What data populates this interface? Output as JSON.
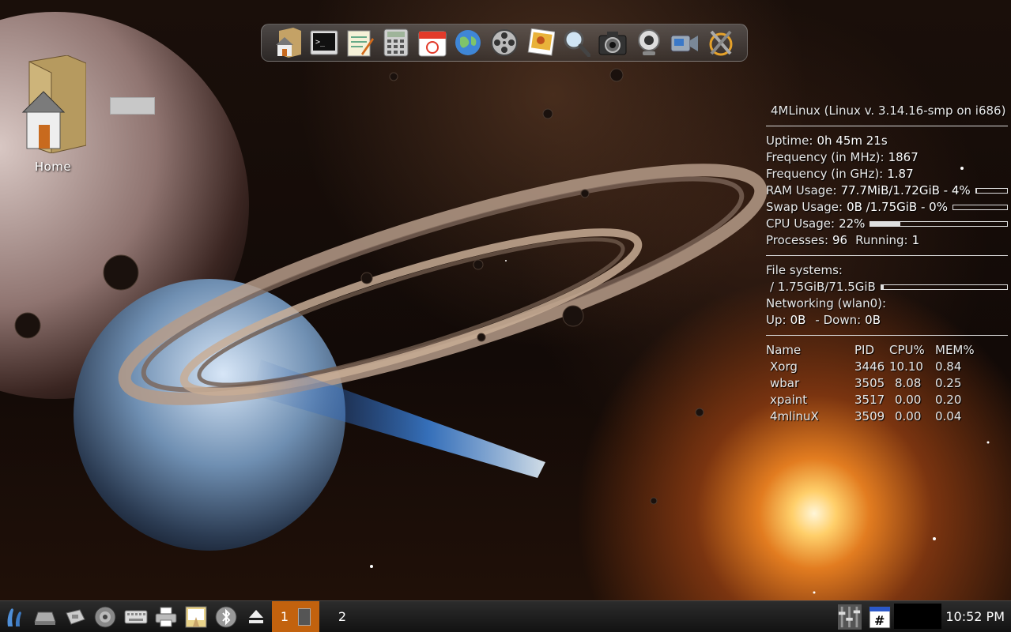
{
  "desktop": {
    "icons": [
      {
        "label": "Home",
        "icon": "home-folder-icon"
      }
    ]
  },
  "dock": {
    "items": [
      {
        "name": "home-folder-icon"
      },
      {
        "name": "terminal-icon"
      },
      {
        "name": "text-editor-icon"
      },
      {
        "name": "calculator-icon"
      },
      {
        "name": "calendar-icon"
      },
      {
        "name": "web-browser-icon"
      },
      {
        "name": "media-player-icon"
      },
      {
        "name": "image-viewer-icon"
      },
      {
        "name": "magnifier-icon"
      },
      {
        "name": "camera-icon"
      },
      {
        "name": "webcam-icon"
      },
      {
        "name": "video-camera-icon"
      },
      {
        "name": "settings-tools-icon"
      }
    ]
  },
  "conky": {
    "title": "4MLinux (Linux v. 3.14.16-smp on i686)",
    "uptime_label": "Uptime:",
    "uptime": "0h 45m 21s",
    "freq_mhz_label": "Frequency (in MHz):",
    "freq_mhz": "1867",
    "freq_ghz_label": "Frequency (in GHz):",
    "freq_ghz": "1.87",
    "ram_label": "RAM Usage:",
    "ram": "77.7MiB/1.72GiB - 4%",
    "ram_pct": 4,
    "swap_label": "Swap Usage:",
    "swap": "0B  /1.75GiB - 0%",
    "swap_pct": 0,
    "cpu_label": "CPU Usage:",
    "cpu": "22%",
    "cpu_pct": 22,
    "processes_label": "Processes:",
    "processes": "96",
    "running_label": "Running:",
    "running": "1",
    "fs_label": "File systems:",
    "fs_root": "/ 1.75GiB/71.5GiB",
    "fs_pct": 2,
    "net_label": "Networking (wlan0):",
    "up_label": "Up:",
    "up": "0B",
    "down_label": "- Down:",
    "down": "0B",
    "proc_headers": [
      "Name",
      "PID",
      "CPU%",
      "MEM%"
    ],
    "procs": [
      {
        "name": "Xorg",
        "pid": "3446",
        "cpu": "10.10",
        "mem": "0.84"
      },
      {
        "name": "wbar",
        "pid": "3505",
        "cpu": "8.08",
        "mem": "0.25"
      },
      {
        "name": "xpaint",
        "pid": "3517",
        "cpu": "0.00",
        "mem": "0.20"
      },
      {
        "name": "4mlinuX",
        "pid": "3509",
        "cpu": "0.00",
        "mem": "0.04"
      }
    ]
  },
  "taskbar": {
    "launchers": [
      {
        "name": "start-menu-icon"
      },
      {
        "name": "scanner-icon"
      },
      {
        "name": "tools-icon"
      },
      {
        "name": "audio-icon"
      },
      {
        "name": "keyboard-icon"
      },
      {
        "name": "printer-icon"
      },
      {
        "name": "paint-icon"
      },
      {
        "name": "bluetooth-icon"
      },
      {
        "name": "eject-icon"
      }
    ],
    "workspaces": [
      "1",
      "2"
    ],
    "clock": "10:52 PM"
  }
}
